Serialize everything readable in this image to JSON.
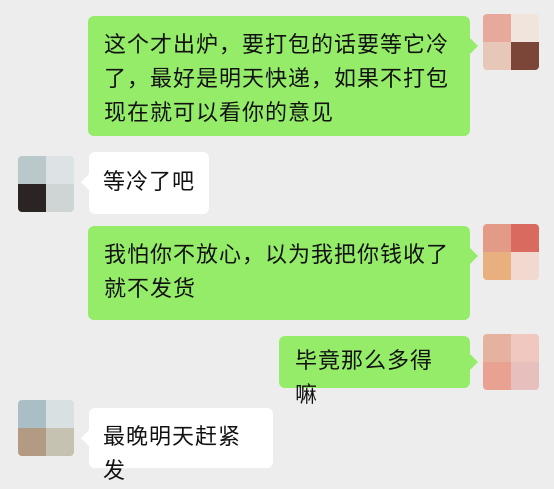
{
  "colors": {
    "background": "#ededed",
    "self_bubble": "#95ec69",
    "other_bubble": "#ffffff"
  },
  "messages": [
    {
      "side": "self",
      "text": "这个才出炉，要打包的话要等它冷了，最好是明天快递，如果不打包现在就可以看你的意见"
    },
    {
      "side": "other",
      "text": "等冷了吧"
    },
    {
      "side": "self",
      "text": "我怕你不放心，以为我把你钱收了就不发货"
    },
    {
      "side": "self",
      "text": "毕竟那么多得嘛"
    },
    {
      "side": "other",
      "text": "最晚明天赶紧发"
    }
  ]
}
